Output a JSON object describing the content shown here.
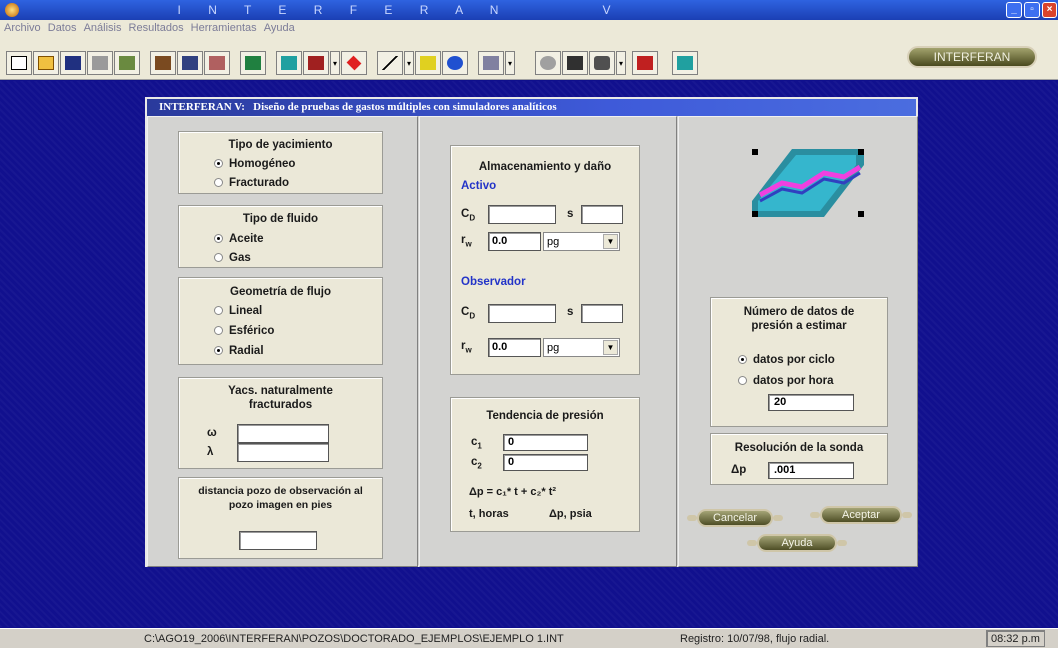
{
  "window": {
    "title": "I N T E R F E R A N      V"
  },
  "menu": [
    "Archivo",
    "Datos",
    "Análisis",
    "Resultados",
    "Herramientas",
    "Ayuda"
  ],
  "toolbar": {
    "brand_button": "INTERFERAN"
  },
  "dialog": {
    "title": "INTERFERAN V:   Diseño de pruebas de gastos múltiples con simuladores analíticos",
    "yacimiento": {
      "title": "Tipo de yacimiento",
      "options": [
        "Homogéneo",
        "Fracturado"
      ],
      "selected": "Homogéneo"
    },
    "fluido": {
      "title": "Tipo de fluido",
      "options": [
        "Aceite",
        "Gas"
      ],
      "selected": "Aceite"
    },
    "geometria": {
      "title": "Geometría de flujo",
      "options": [
        "Lineal",
        "Esférico",
        "Radial"
      ],
      "selected": "Radial"
    },
    "nfr": {
      "title_l1": "Yacs. naturalmente",
      "title_l2": "fracturados",
      "omega_label": "ω",
      "lambda_label": "λ",
      "omega_value": "",
      "lambda_value": ""
    },
    "distancia": {
      "title_l1": "distancia pozo de observación al",
      "title_l2": "pozo imagen en pies",
      "value": ""
    },
    "almacenamiento": {
      "title": "Almacenamiento y daño",
      "activo_label": "Activo",
      "observador_label": "Observador",
      "cd_label": "C",
      "cd_sub": "D",
      "s_label": "s",
      "rw_label": "r",
      "rw_sub": "w",
      "activo_cd": "",
      "activo_s": "",
      "activo_rw": "0.0",
      "activo_unit": "pg",
      "obs_cd": "",
      "obs_s": "",
      "obs_rw": "0.0",
      "obs_unit": "pg"
    },
    "tendencia": {
      "title": "Tendencia de presión",
      "c1_label": "c",
      "c1_sub": "1",
      "c1_value": "0",
      "c2_label": "c",
      "c2_sub": "2",
      "c2_value": "0",
      "formula": "Δp = c₁* t  +  c₂* t²",
      "t_label": "t, horas",
      "p_label": "Δp, psia"
    },
    "numero_datos": {
      "title_l1": "Número de datos de",
      "title_l2": "presión a estimar",
      "options": [
        "datos por ciclo",
        "datos por hora"
      ],
      "selected": "datos por ciclo",
      "value": "20"
    },
    "resolucion": {
      "title": "Resolución de la sonda",
      "label": "Δp",
      "value": ".001"
    },
    "buttons": {
      "cancelar": "Cancelar",
      "aceptar": "Aceptar",
      "ayuda": "Ayuda"
    }
  },
  "status": {
    "path": "C:\\AGO19_2006\\INTERFERAN\\POZOS\\DOCTORADO_EJEMPLOS\\EJEMPLO 1.INT",
    "registro": "Registro: 10/07/98, flujo radial.",
    "clock": "08:32 p.m"
  },
  "colors": {
    "desktop": "#11108e",
    "dialog_title": "#2a3a9c",
    "label_blue": "#2233c8",
    "panel": "#ebe8d8"
  }
}
